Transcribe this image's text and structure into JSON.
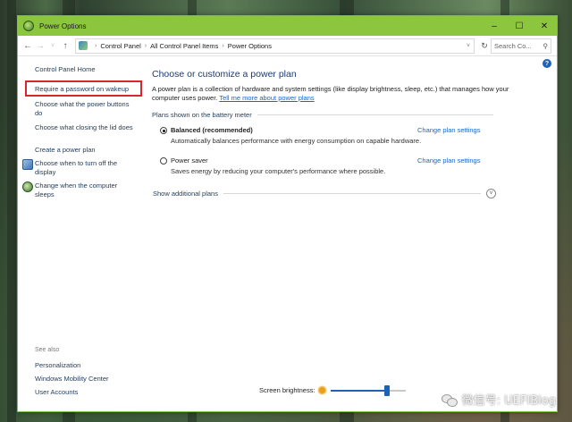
{
  "window": {
    "title": "Power Options"
  },
  "address": {
    "crumbs": [
      "Control Panel",
      "All Control Panel Items",
      "Power Options"
    ],
    "search_placeholder": "Search Co..."
  },
  "sidebar": {
    "home": "Control Panel Home",
    "links": [
      "Require a password on wakeup",
      "Choose what the power buttons do",
      "Choose what closing the lid does",
      "Create a power plan",
      "Choose when to turn off the display",
      "Change when the computer sleeps"
    ],
    "see_also_label": "See also",
    "see_also": [
      "Personalization",
      "Windows Mobility Center",
      "User Accounts"
    ]
  },
  "main": {
    "heading": "Choose or customize a power plan",
    "description": "A power plan is a collection of hardware and system settings (like display brightness, sleep, etc.) that manages how your computer uses power.",
    "description_link": "Tell me more about power plans",
    "section_label": "Plans shown on the battery meter",
    "plans": [
      {
        "name": "Balanced (recommended)",
        "desc": "Automatically balances performance with energy consumption on capable hardware.",
        "link": "Change plan settings",
        "selected": true
      },
      {
        "name": "Power saver",
        "desc": "Saves energy by reducing your computer's performance where possible.",
        "link": "Change plan settings",
        "selected": false
      }
    ],
    "additional": "Show additional plans"
  },
  "brightness": {
    "label": "Screen brightness:",
    "level": 0.75
  },
  "watermark": "微信号: UEFIBlog",
  "colors": {
    "title_bar": "#8cc63f",
    "link": "#1a66c5",
    "highlight_box": "#d8262e",
    "heading": "#1e3a6e"
  }
}
